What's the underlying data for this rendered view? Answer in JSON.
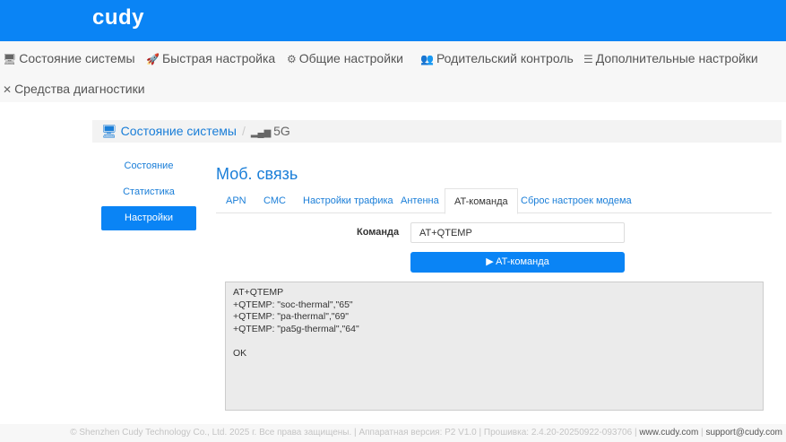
{
  "brand": "cudy",
  "nav": [
    {
      "label": "Состояние системы",
      "icon": "monitor-icon"
    },
    {
      "label": "Быстрая настройка",
      "icon": "rocket-icon"
    },
    {
      "label": "Общие настройки",
      "icon": "gear-icon"
    },
    {
      "label": "Родительский контроль",
      "icon": "users-icon"
    },
    {
      "label": "Дополнительные настройки",
      "icon": "sliders-icon"
    },
    {
      "label": "Средства диагностики",
      "icon": "tools-icon"
    }
  ],
  "breadcrumb": {
    "root": "Состояние системы",
    "sep": "/",
    "current": "5G"
  },
  "sidebar": [
    {
      "label": "Состояние"
    },
    {
      "label": "Статистика"
    },
    {
      "label": "Настройки",
      "active": true
    }
  ],
  "page_title": "Моб. связь",
  "tabs": [
    {
      "label": "APN"
    },
    {
      "label": "СМС"
    },
    {
      "label": "Настройки трафика"
    },
    {
      "label": "Антенна"
    },
    {
      "label": "AT-команда",
      "active": true
    },
    {
      "label": "Сброс настроек модема"
    }
  ],
  "form": {
    "command_label": "Команда",
    "command_value": "AT+QTEMP",
    "submit_label": "AT-команда"
  },
  "output": "AT+QTEMP\n+QTEMP: \"soc-thermal\",\"65\"\n+QTEMP: \"pa-thermal\",\"69\"\n+QTEMP: \"pa5g-thermal\",\"64\"\n\nOK",
  "footer": {
    "copyright": "© Shenzhen Cudy Technology Co., Ltd. 2025 г. Все права защищены.",
    "hardware": "Аппаратная версия: P2 V1.0",
    "firmware": "Прошивка: 2.4.20-20250922-093706",
    "site": "www.cudy.com",
    "email": "support@cudy.com"
  },
  "colors": {
    "accent": "#0a84f5",
    "link": "#1a7ed8"
  }
}
